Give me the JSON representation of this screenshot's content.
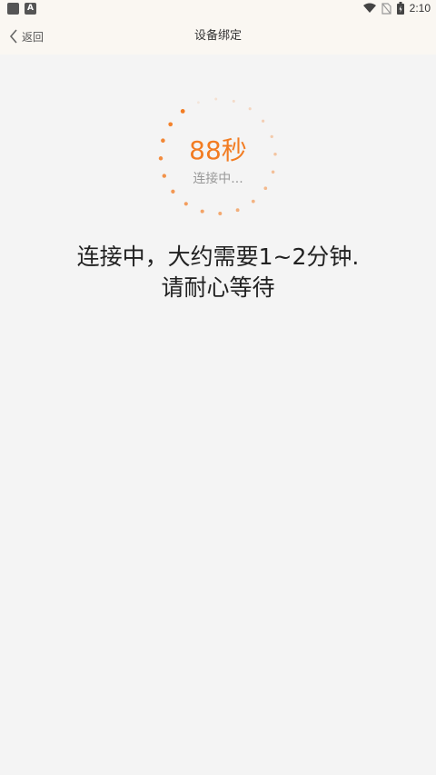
{
  "status_bar": {
    "time": "2:10",
    "icons": [
      "app-square-icon",
      "a-badge-icon",
      "wifi-icon",
      "no-sim-icon",
      "battery-icon"
    ]
  },
  "nav": {
    "back_label": "返回",
    "title": "设备绑定"
  },
  "progress": {
    "countdown": "88秒",
    "status": "连接中..."
  },
  "message": {
    "line1": "连接中，大约需要1~2分钟.",
    "line2": "请耐心等待"
  },
  "colors": {
    "accent": "#f27c22",
    "bar_bg": "#faf7f2",
    "page_bg": "#f4f4f4"
  }
}
